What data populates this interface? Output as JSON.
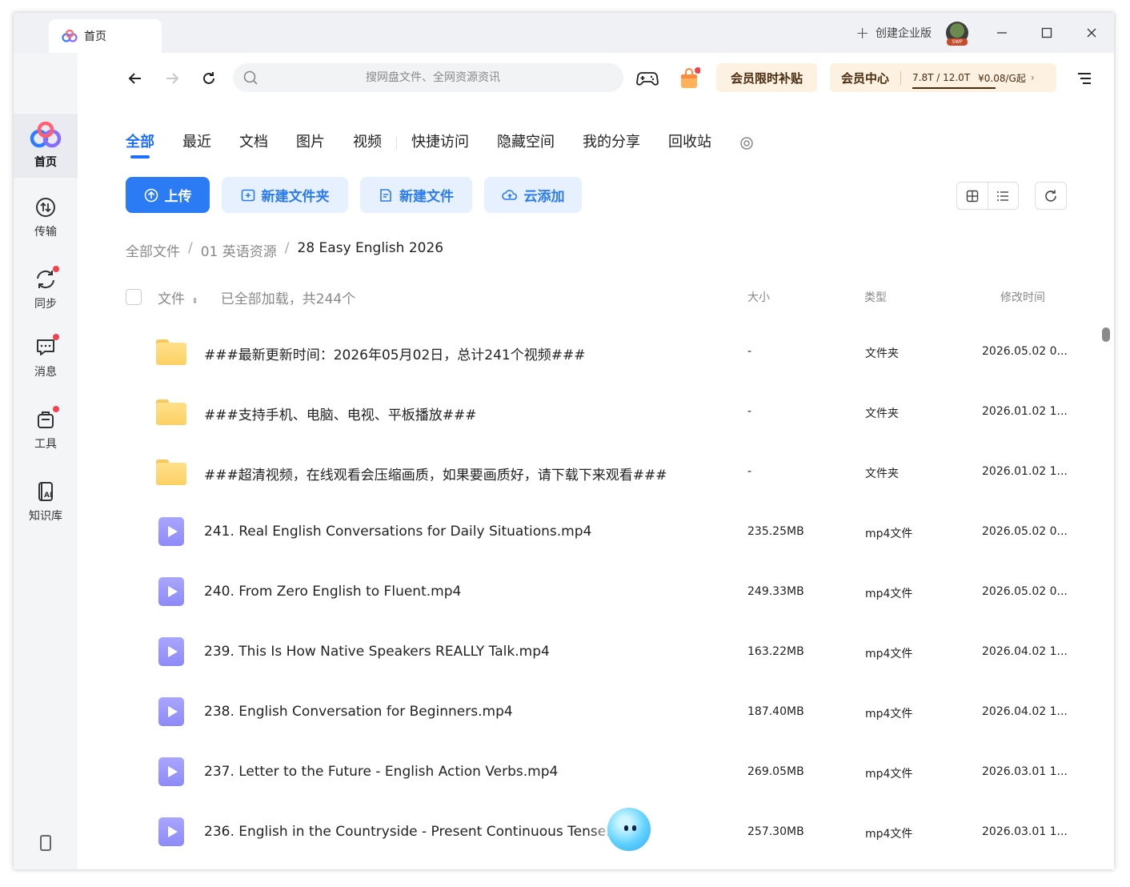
{
  "titlebar": {
    "tab_label": "首页",
    "create_enterprise": "创建企业版",
    "avatar_tag": "SWP"
  },
  "sidebar": {
    "items": [
      {
        "label": "首页",
        "icon": "cloud-logo-icon",
        "active": true
      },
      {
        "label": "传输",
        "icon": "transfer-icon"
      },
      {
        "label": "同步",
        "icon": "sync-icon"
      },
      {
        "label": "消息",
        "icon": "message-icon"
      },
      {
        "label": "工具",
        "icon": "toolbox-icon"
      },
      {
        "label": "知识库",
        "icon": "ai-knowledge-icon"
      }
    ]
  },
  "navbar": {
    "search_placeholder": "搜网盘文件、全网资源资讯",
    "promo_label": "会员限时补贴",
    "vip_label": "会员中心",
    "storage": "7.8T / 12.0T",
    "price": "¥0.08/G起",
    "price_arrow": "›"
  },
  "filters": [
    "全部",
    "最近",
    "文档",
    "图片",
    "视频",
    "快捷访问",
    "隐藏空间",
    "我的分享",
    "回收站"
  ],
  "actions": {
    "upload": "上传",
    "new_folder": "新建文件夹",
    "new_file": "新建文件",
    "cloud_add": "云添加"
  },
  "breadcrumb": [
    "全部文件",
    "01 英语资源",
    "28 Easy English 2026"
  ],
  "table": {
    "col_name": "文件",
    "loaded_info": "已全部加载，共244个",
    "col_size": "大小",
    "col_type": "类型",
    "col_time": "修改时间",
    "rows": [
      {
        "kind": "folder",
        "name": "###最新更新时间：2026年05月02日，总计241个视频###",
        "size": "-",
        "type": "文件夹",
        "time": "2026.05.02 0..."
      },
      {
        "kind": "folder",
        "name": "###支持手机、电脑、电视、平板播放###",
        "size": "-",
        "type": "文件夹",
        "time": "2026.01.02 1..."
      },
      {
        "kind": "folder",
        "name": "###超清视频，在线观看会压缩画质，如果要画质好，请下载下来观看###",
        "size": "-",
        "type": "文件夹",
        "time": "2026.01.02 1..."
      },
      {
        "kind": "video",
        "name": "241. Real English Conversations for Daily Situations.mp4",
        "size": "235.25MB",
        "type": "mp4文件",
        "time": "2026.05.02 0..."
      },
      {
        "kind": "video",
        "name": "240. From Zero English to Fluent.mp4",
        "size": "249.33MB",
        "type": "mp4文件",
        "time": "2026.05.02 0..."
      },
      {
        "kind": "video",
        "name": "239. This Is How Native Speakers REALLY Talk.mp4",
        "size": "163.22MB",
        "type": "mp4文件",
        "time": "2026.04.02 1..."
      },
      {
        "kind": "video",
        "name": "238. English Conversation for Beginners.mp4",
        "size": "187.40MB",
        "type": "mp4文件",
        "time": "2026.04.02 1..."
      },
      {
        "kind": "video",
        "name": "237. Letter to the Future - English Action Verbs.mp4",
        "size": "269.05MB",
        "type": "mp4文件",
        "time": "2026.03.01 1..."
      },
      {
        "kind": "video",
        "name": "236. English in the Countryside - Present Continuous Tense.",
        "size": "257.30MB",
        "type": "mp4文件",
        "time": "2026.03.01 1..."
      }
    ]
  },
  "colors": {
    "accent": "#2a7bf4",
    "accent_light": "#e6f0fe",
    "promo_bg": "#fdf1e2",
    "badge_red": "#f5404f"
  }
}
